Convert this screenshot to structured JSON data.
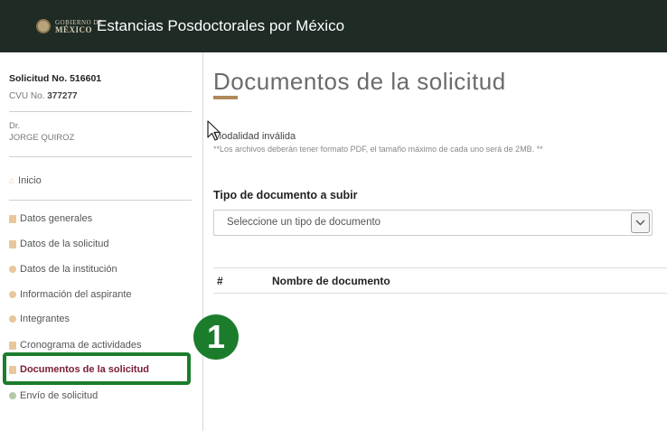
{
  "header": {
    "logo_line1": "GOBIERNO DE",
    "logo_line2": "MÉXICO",
    "app_title": "Estancias Posdoctorales por México"
  },
  "sidebar": {
    "solicitud": "Solicitud No. 516601",
    "cvu_prefix": "CVU No. ",
    "cvu_value": "377277",
    "title": "Dr.",
    "name": "JORGE QUIROZ",
    "home": "Inicio",
    "items": [
      {
        "label": "Datos generales",
        "icon": "document-icon"
      },
      {
        "label": "Datos de la solicitud",
        "icon": "document-icon"
      },
      {
        "label": "Datos de la institución",
        "icon": "person-icon"
      },
      {
        "label": "Información del aspirante",
        "icon": "people-icon"
      },
      {
        "label": "Integrantes",
        "icon": "people-icon"
      },
      {
        "label": "Cronograma de actividades",
        "icon": "calendar-icon"
      },
      {
        "label": "Documentos de la solicitud",
        "icon": "document-icon"
      },
      {
        "label": "Envío de solicitud",
        "icon": "check-circle-icon"
      }
    ],
    "active_index": 6
  },
  "annotation": {
    "step_number": "1",
    "color": "#1b7d2c"
  },
  "main": {
    "title": "Documentos de la solicitud",
    "modalidad": "Modalidad inválida",
    "note": "**Los archivos deberán tener formato PDF, el tamaño máximo de cada uno será de 2MB. **",
    "tipo_label": "Tipo de documento a subir",
    "select_placeholder": "Seleccione un tipo de documento",
    "table_headers": [
      "#",
      "Nombre de documento"
    ]
  },
  "colors": {
    "topbar": "#1f2b25",
    "accent": "#b08a5b",
    "active": "#7a1c35"
  }
}
